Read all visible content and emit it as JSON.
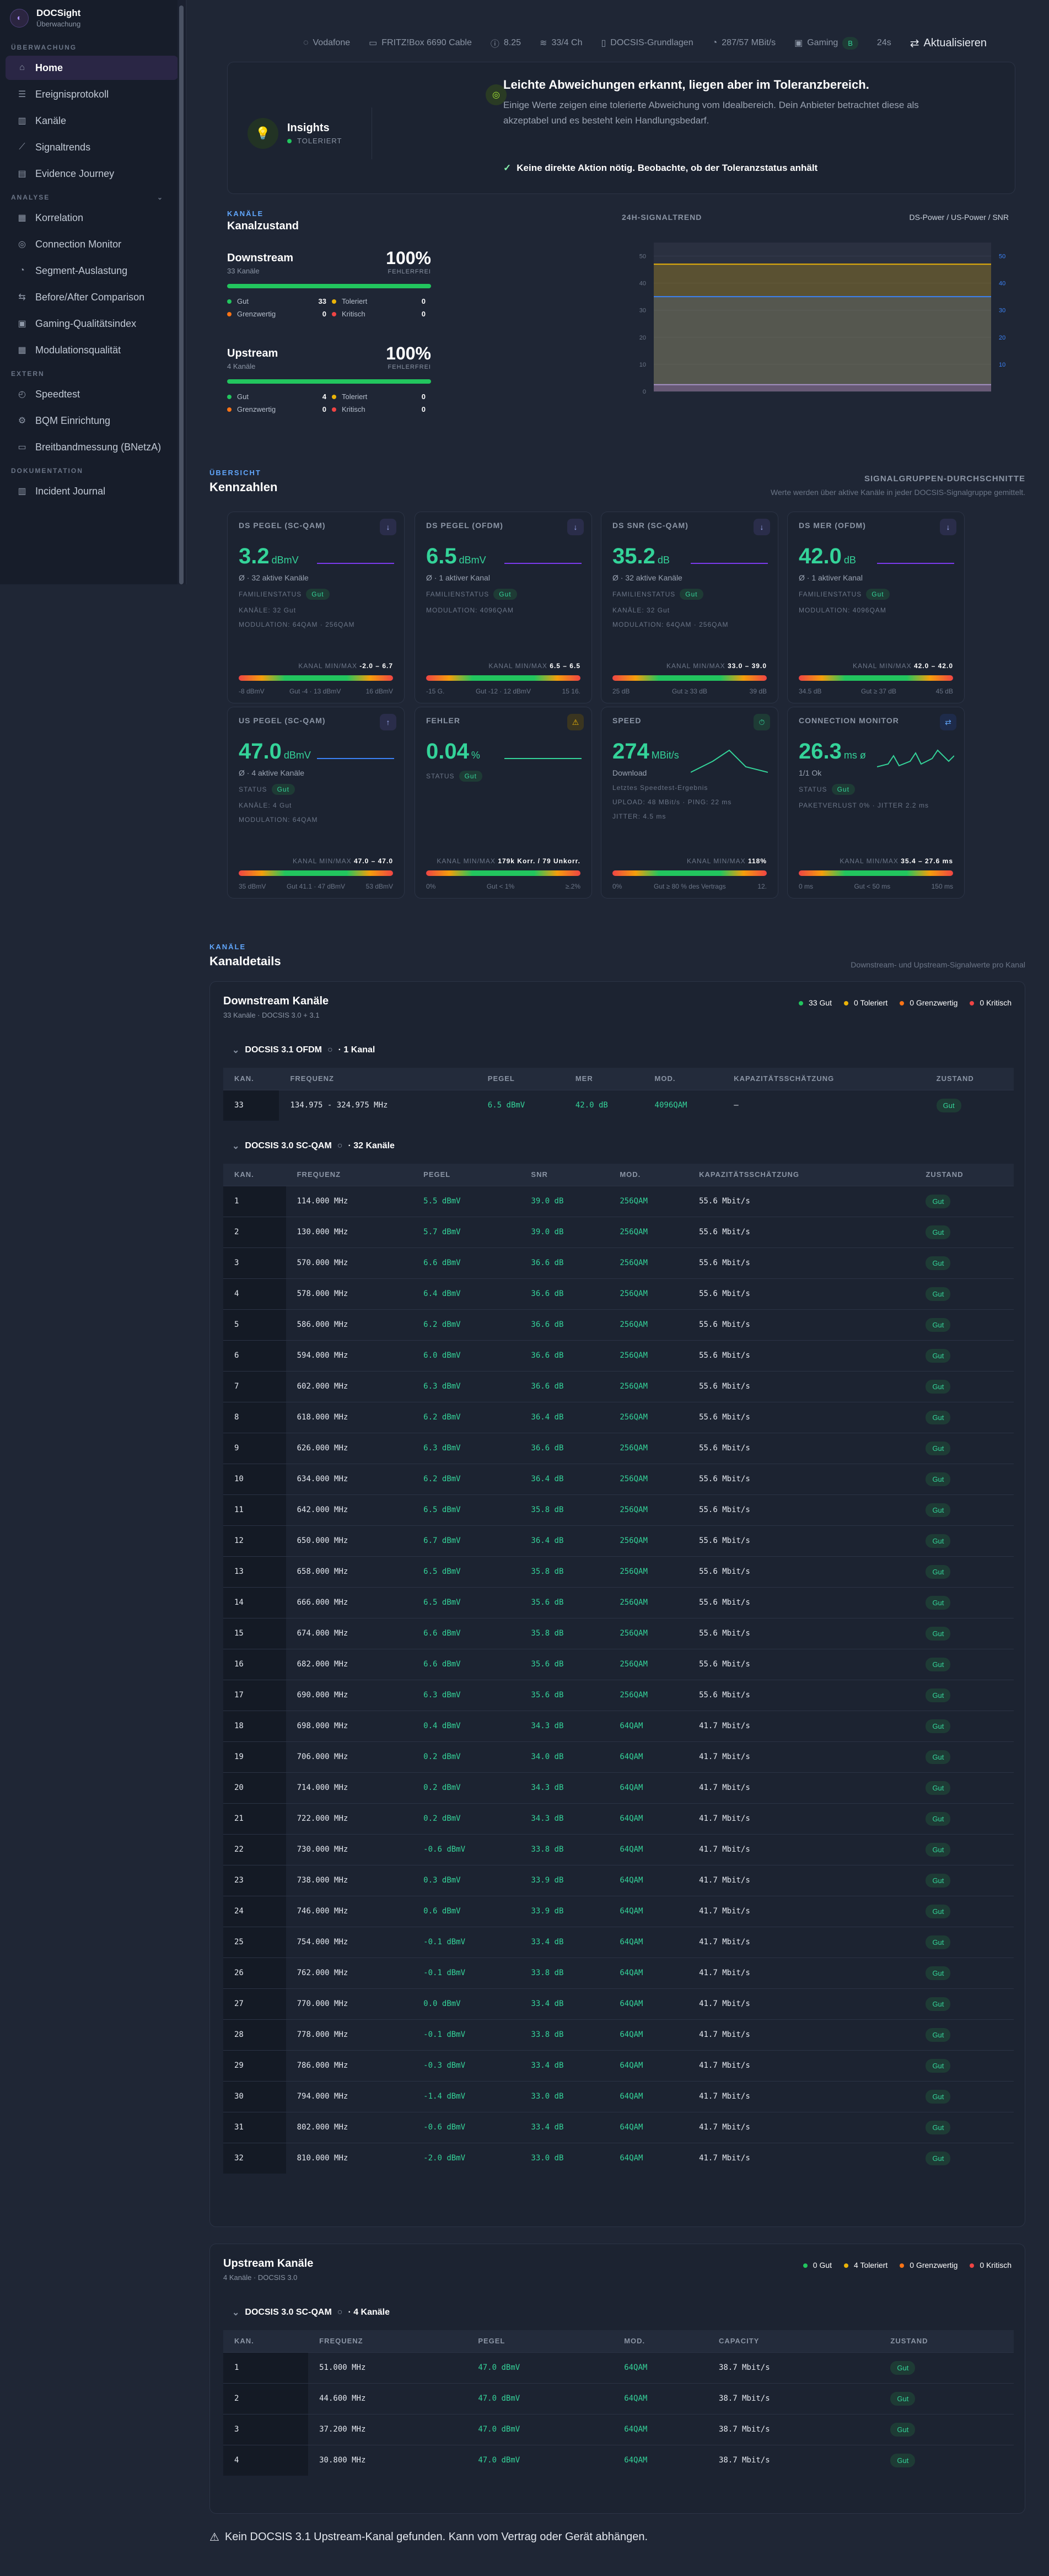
{
  "brand": {
    "name": "DOCSight",
    "sub": "Überwachung"
  },
  "sidebar": {
    "sections": [
      {
        "label": "ÜBERWACHUNG",
        "items": [
          {
            "label": "Home",
            "icon": "home-icon",
            "active": true
          },
          {
            "label": "Ereignisprotokoll",
            "icon": "list-icon"
          },
          {
            "label": "Kanäle",
            "icon": "bars-icon"
          },
          {
            "label": "Signaltrends",
            "icon": "trend-icon"
          },
          {
            "label": "Evidence Journey",
            "icon": "doc-icon"
          }
        ]
      },
      {
        "label": "ANALYSE",
        "items": [
          {
            "label": "Korrelation",
            "icon": "chart-icon"
          },
          {
            "label": "Connection Monitor",
            "icon": "monitor-icon"
          },
          {
            "label": "Segment-Auslastung",
            "icon": "pie-icon"
          },
          {
            "label": "Before/After Comparison",
            "icon": "compare-icon"
          },
          {
            "label": "Gaming-Qualitätsindex",
            "icon": "gamepad-icon"
          },
          {
            "label": "Modulationsqualität",
            "icon": "grid-icon"
          }
        ]
      },
      {
        "label": "EXTERN",
        "items": [
          {
            "label": "Speedtest",
            "icon": "speed-icon"
          },
          {
            "label": "BQM Einrichtung",
            "icon": "gear-icon"
          },
          {
            "label": "Breitbandmessung (BNetzA)",
            "icon": "ruler-icon"
          }
        ]
      },
      {
        "label": "DOKUMENTATION",
        "items": [
          {
            "label": "Incident Journal",
            "icon": "journal-icon"
          }
        ]
      }
    ]
  },
  "topbar": {
    "isp": "Vodafone",
    "router": "FRITZ!Box 6690 Cable",
    "version": "8.25",
    "channels": "33/4 Ch",
    "docsis": "DOCSIS-Grundlagen",
    "speed": "287/57 MBit/s",
    "gaming": "Gaming",
    "gaming_score": "B",
    "age": "24s",
    "refresh": "Aktualisieren"
  },
  "insight": {
    "title": "Insights",
    "status": "TOLERIERT",
    "headline": "Leichte Abweichungen erkannt, liegen aber im Toleranzbereich.",
    "text": "Einige Werte zeigen eine tolerierte Abweichung vom Idealbereich. Dein Anbieter betrachtet diese als akzeptabel und es besteht kein Handlungsbedarf.",
    "action": "Keine direkte Aktion nötig. Beobachte, ob der Toleranzstatus anhält"
  },
  "kanalzustand": {
    "eyebrow": "KANÄLE",
    "title": "Kanalzustand",
    "downstream": {
      "name": "Downstream",
      "sub": "33 Kanäle",
      "pct": "100%",
      "label": "FEHLERFREI",
      "gut": "33",
      "toleriert": "0",
      "grenzwertig": "0",
      "kritisch": "0"
    },
    "upstream": {
      "name": "Upstream",
      "sub": "4 Kanäle",
      "pct": "100%",
      "label": "FEHLERFREI",
      "gut": "4",
      "toleriert": "0",
      "grenzwertig": "0",
      "kritisch": "0"
    },
    "labels": {
      "gut": "Gut",
      "toleriert": "Toleriert",
      "grenzwertig": "Grenzwertig",
      "kritisch": "Kritisch"
    }
  },
  "chart24": {
    "title": "24H-SIGNALTREND",
    "legend": "DS-Power / US-Power / SNR"
  },
  "chart_data": {
    "type": "line",
    "title": "24H-SIGNALTREND",
    "y_left": [
      0,
      10,
      20,
      30,
      40,
      50
    ],
    "y_right": [
      10,
      20,
      30,
      40,
      50
    ],
    "series": [
      {
        "name": "DS-Power",
        "values": [
          2.5,
          2.5,
          2.5,
          2.5,
          2.5,
          2.5
        ]
      },
      {
        "name": "US-Power",
        "values": [
          47,
          47,
          47,
          47,
          47,
          47
        ]
      },
      {
        "name": "SNR",
        "values": [
          35,
          35,
          35,
          35,
          35,
          35
        ]
      }
    ]
  },
  "kennzahlen": {
    "eyebrow": "ÜBERSICHT",
    "title": "Kennzahlen",
    "sg_title": "SIGNALGRUPPEN-DURCHSCHNITTE",
    "sg_sub": "Werte werden über aktive Kanäle in jeder DOCSIS-Signalgruppe gemittelt.",
    "cards": [
      {
        "label": "DS PEGEL (SC-QAM)",
        "value": "3.2",
        "unit": "dBmV",
        "sub": "Ø · 32 aktive Kanäle",
        "l1": "FAMILIENSTATUS",
        "l2": "KANÄLE: 32 Gut",
        "l3": "MODULATION: 64QAM · 256QAM",
        "rng": "-2.0 – 6.7",
        "t1": "-8 dBmV",
        "t2": "Gut -4 · 13 dBmV",
        "t3": "16 dBmV"
      },
      {
        "label": "DS PEGEL (OFDM)",
        "value": "6.5",
        "unit": "dBmV",
        "sub": "Ø · 1 aktiver Kanal",
        "l1": "FAMILIENSTATUS",
        "l2": "MODULATION: 4096QAM",
        "l3": "",
        "rng": "6.5 – 6.5",
        "t1": "-15 G.",
        "t2": "Gut -12 · 12 dBmV",
        "t3": "15 16."
      },
      {
        "label": "DS SNR (SC-QAM)",
        "value": "35.2",
        "unit": "dB",
        "sub": "Ø · 32 aktive Kanäle",
        "l1": "FAMILIENSTATUS",
        "l2": "KANÄLE: 32 Gut",
        "l3": "MODULATION: 64QAM · 256QAM",
        "rng": "33.0 – 39.0",
        "t1": "25 dB",
        "t2": "Gut ≥ 33 dB",
        "t3": "39 dB"
      },
      {
        "label": "DS MER (OFDM)",
        "value": "42.0",
        "unit": "dB",
        "sub": "Ø · 1 aktiver Kanal",
        "l1": "FAMILIENSTATUS",
        "l2": "MODULATION: 4096QAM",
        "l3": "",
        "rng": "42.0 – 42.0",
        "t1": "34.5 dB",
        "t2": "Gut ≥ 37 dB",
        "t3": "45 dB"
      },
      {
        "label": "US PEGEL (SC-QAM)",
        "value": "47.0",
        "unit": "dBmV",
        "sub": "Ø · 4 aktive Kanäle",
        "l1": "STATUS",
        "l2": "KANÄLE: 4 Gut",
        "l3": "MODULATION: 64QAM",
        "rng": "47.0 – 47.0",
        "t1": "35 dBmV",
        "t2": "Gut 41.1 · 47 dBmV",
        "t3": "53 dBmV"
      },
      {
        "label": "FEHLER",
        "value": "0.04",
        "unit": "%",
        "sub": "",
        "l1": "STATUS",
        "l2": "",
        "l3": "",
        "rng": "179k Korr. / 79 Unkorr.",
        "t1": "0%",
        "t2": "Gut < 1%",
        "t3": "≥.2%"
      },
      {
        "label": "SPEED",
        "value": "274",
        "unit": "MBit/s",
        "sub": "Download",
        "l1": "Letztes Speedtest-Ergebnis",
        "l2": "UPLOAD: 48 MBit/s · PING: 22 ms",
        "l3": "JITTER: 4.5 ms",
        "rng": "118%",
        "t1": "0%",
        "t2": "Gut ≥ 80 % des Vertrags",
        "t3": "12."
      },
      {
        "label": "CONNECTION MONITOR",
        "value": "26.3",
        "unit": "ms ø",
        "sub": "1/1 Ok",
        "l1": "STATUS",
        "l2": "PAKETVERLUST 0% · JITTER 2.2 ms",
        "l3": "",
        "rng": "35.4 – 27.6 ms",
        "t1": "0 ms",
        "t2": "Gut < 50 ms",
        "t3": "150 ms"
      }
    ]
  },
  "kanaldetails": {
    "eyebrow": "KANÄLE",
    "title": "Kanaldetails",
    "sub": "Downstream- und Upstream-Signalwerte pro Kanal",
    "ds": {
      "title": "Downstream Kanäle",
      "sub": "33 Kanäle · DOCSIS 3.0 + 3.1",
      "legend": [
        "33 Gut",
        "0 Toleriert",
        "0 Grenzwertig",
        "0 Kritisch"
      ],
      "ofdm": {
        "label": "DOCSIS 3.1 OFDM",
        "count": "· 1 Kanal",
        "headers": [
          "KAN.",
          "FREQUENZ",
          "PEGEL",
          "MER",
          "MOD.",
          "KAPAZITÄTSSCHÄTZUNG",
          "ZUSTAND"
        ],
        "rows": [
          [
            "33",
            "134.975 - 324.975 MHz",
            "6.5 dBmV",
            "42.0 dB",
            "4096QAM",
            "–",
            "Gut"
          ]
        ]
      },
      "scqam": {
        "label": "DOCSIS 3.0 SC-QAM",
        "count": "· 32 Kanäle",
        "headers": [
          "KAN.",
          "FREQUENZ",
          "PEGEL",
          "SNR",
          "MOD.",
          "KAPAZITÄTSSCHÄTZUNG",
          "ZUSTAND"
        ],
        "rows": [
          [
            "1",
            "114.000 MHz",
            "5.5 dBmV",
            "39.0 dB",
            "256QAM",
            "55.6 Mbit/s",
            "Gut"
          ],
          [
            "2",
            "130.000 MHz",
            "5.7 dBmV",
            "39.0 dB",
            "256QAM",
            "55.6 Mbit/s",
            "Gut"
          ],
          [
            "3",
            "570.000 MHz",
            "6.6 dBmV",
            "36.6 dB",
            "256QAM",
            "55.6 Mbit/s",
            "Gut"
          ],
          [
            "4",
            "578.000 MHz",
            "6.4 dBmV",
            "36.6 dB",
            "256QAM",
            "55.6 Mbit/s",
            "Gut"
          ],
          [
            "5",
            "586.000 MHz",
            "6.2 dBmV",
            "36.6 dB",
            "256QAM",
            "55.6 Mbit/s",
            "Gut"
          ],
          [
            "6",
            "594.000 MHz",
            "6.0 dBmV",
            "36.6 dB",
            "256QAM",
            "55.6 Mbit/s",
            "Gut"
          ],
          [
            "7",
            "602.000 MHz",
            "6.3 dBmV",
            "36.6 dB",
            "256QAM",
            "55.6 Mbit/s",
            "Gut"
          ],
          [
            "8",
            "618.000 MHz",
            "6.2 dBmV",
            "36.4 dB",
            "256QAM",
            "55.6 Mbit/s",
            "Gut"
          ],
          [
            "9",
            "626.000 MHz",
            "6.3 dBmV",
            "36.6 dB",
            "256QAM",
            "55.6 Mbit/s",
            "Gut"
          ],
          [
            "10",
            "634.000 MHz",
            "6.2 dBmV",
            "36.4 dB",
            "256QAM",
            "55.6 Mbit/s",
            "Gut"
          ],
          [
            "11",
            "642.000 MHz",
            "6.5 dBmV",
            "35.8 dB",
            "256QAM",
            "55.6 Mbit/s",
            "Gut"
          ],
          [
            "12",
            "650.000 MHz",
            "6.7 dBmV",
            "36.4 dB",
            "256QAM",
            "55.6 Mbit/s",
            "Gut"
          ],
          [
            "13",
            "658.000 MHz",
            "6.5 dBmV",
            "35.8 dB",
            "256QAM",
            "55.6 Mbit/s",
            "Gut"
          ],
          [
            "14",
            "666.000 MHz",
            "6.5 dBmV",
            "35.6 dB",
            "256QAM",
            "55.6 Mbit/s",
            "Gut"
          ],
          [
            "15",
            "674.000 MHz",
            "6.6 dBmV",
            "35.8 dB",
            "256QAM",
            "55.6 Mbit/s",
            "Gut"
          ],
          [
            "16",
            "682.000 MHz",
            "6.6 dBmV",
            "35.6 dB",
            "256QAM",
            "55.6 Mbit/s",
            "Gut"
          ],
          [
            "17",
            "690.000 MHz",
            "6.3 dBmV",
            "35.6 dB",
            "256QAM",
            "55.6 Mbit/s",
            "Gut"
          ],
          [
            "18",
            "698.000 MHz",
            "0.4 dBmV",
            "34.3 dB",
            "64QAM",
            "41.7 Mbit/s",
            "Gut"
          ],
          [
            "19",
            "706.000 MHz",
            "0.2 dBmV",
            "34.0 dB",
            "64QAM",
            "41.7 Mbit/s",
            "Gut"
          ],
          [
            "20",
            "714.000 MHz",
            "0.2 dBmV",
            "34.3 dB",
            "64QAM",
            "41.7 Mbit/s",
            "Gut"
          ],
          [
            "21",
            "722.000 MHz",
            "0.2 dBmV",
            "34.3 dB",
            "64QAM",
            "41.7 Mbit/s",
            "Gut"
          ],
          [
            "22",
            "730.000 MHz",
            "-0.6 dBmV",
            "33.8 dB",
            "64QAM",
            "41.7 Mbit/s",
            "Gut"
          ],
          [
            "23",
            "738.000 MHz",
            "0.3 dBmV",
            "33.9 dB",
            "64QAM",
            "41.7 Mbit/s",
            "Gut"
          ],
          [
            "24",
            "746.000 MHz",
            "0.6 dBmV",
            "33.9 dB",
            "64QAM",
            "41.7 Mbit/s",
            "Gut"
          ],
          [
            "25",
            "754.000 MHz",
            "-0.1 dBmV",
            "33.4 dB",
            "64QAM",
            "41.7 Mbit/s",
            "Gut"
          ],
          [
            "26",
            "762.000 MHz",
            "-0.1 dBmV",
            "33.8 dB",
            "64QAM",
            "41.7 Mbit/s",
            "Gut"
          ],
          [
            "27",
            "770.000 MHz",
            "0.0 dBmV",
            "33.4 dB",
            "64QAM",
            "41.7 Mbit/s",
            "Gut"
          ],
          [
            "28",
            "778.000 MHz",
            "-0.1 dBmV",
            "33.8 dB",
            "64QAM",
            "41.7 Mbit/s",
            "Gut"
          ],
          [
            "29",
            "786.000 MHz",
            "-0.3 dBmV",
            "33.4 dB",
            "64QAM",
            "41.7 Mbit/s",
            "Gut"
          ],
          [
            "30",
            "794.000 MHz",
            "-1.4 dBmV",
            "33.0 dB",
            "64QAM",
            "41.7 Mbit/s",
            "Gut"
          ],
          [
            "31",
            "802.000 MHz",
            "-0.6 dBmV",
            "33.4 dB",
            "64QAM",
            "41.7 Mbit/s",
            "Gut"
          ],
          [
            "32",
            "810.000 MHz",
            "-2.0 dBmV",
            "33.0 dB",
            "64QAM",
            "41.7 Mbit/s",
            "Gut"
          ]
        ]
      }
    },
    "us": {
      "title": "Upstream Kanäle",
      "sub": "4 Kanäle · DOCSIS 3.0",
      "legend": [
        "0 Gut",
        "4 Toleriert",
        "0 Grenzwertig",
        "0 Kritisch"
      ],
      "scqam": {
        "label": "DOCSIS 3.0 SC-QAM",
        "count": "· 4 Kanäle",
        "headers": [
          "KAN.",
          "FREQUENZ",
          "PEGEL",
          "MOD.",
          "CAPACITY",
          "ZUSTAND"
        ],
        "rows": [
          [
            "1",
            "51.000 MHz",
            "47.0 dBmV",
            "64QAM",
            "38.7 Mbit/s",
            "Gut"
          ],
          [
            "2",
            "44.600 MHz",
            "47.0 dBmV",
            "64QAM",
            "38.7 Mbit/s",
            "Gut"
          ],
          [
            "3",
            "37.200 MHz",
            "47.0 dBmV",
            "64QAM",
            "38.7 Mbit/s",
            "Gut"
          ],
          [
            "4",
            "30.800 MHz",
            "47.0 dBmV",
            "64QAM",
            "38.7 Mbit/s",
            "Gut"
          ]
        ]
      }
    }
  },
  "footer": {
    "warning": "Kein DOCSIS 3.1 Upstream-Kanal gefunden. Kann vom Vertrag oder Gerät abhängen."
  }
}
